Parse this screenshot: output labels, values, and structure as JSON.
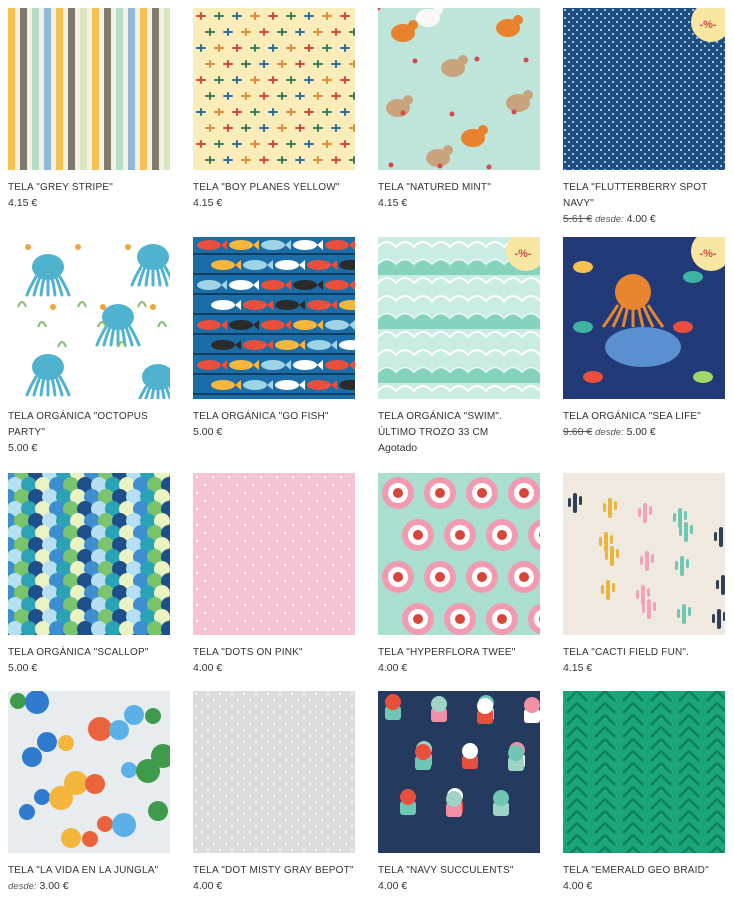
{
  "sale_badge": "-%-",
  "from_label": "desde:",
  "products": [
    {
      "title": "TELA \"GREY STRIPE\"",
      "price": "4.15 €",
      "icon": "stripes-pattern"
    },
    {
      "title": "TELA \"BOY PLANES YELLOW\"",
      "price": "4.15 €",
      "icon": "planes-pattern"
    },
    {
      "title": "TELA \"NATURED MINT\"",
      "price": "4.15 €",
      "icon": "forest-animals-pattern"
    },
    {
      "title": "TELA \"FLUTTERBERRY SPOT NAVY\"",
      "old_price": "5.61 €",
      "price": "4.00 €",
      "sale": true,
      "icon": "navy-dots-pattern"
    },
    {
      "title": "TELA ORGÁNICA \"OCTOPUS PARTY\"",
      "price": "5.00 €",
      "icon": "octopus-pattern"
    },
    {
      "title": "TELA ORGÁNICA \"GO FISH\"",
      "price": "5.00 €",
      "icon": "fish-pattern"
    },
    {
      "title": "TELA ORGÁNICA \"SWIM\". ÚLTIMO TROZO 33 CM",
      "status": "Agotado",
      "sale": true,
      "icon": "waves-pattern"
    },
    {
      "title": "TELA ORGÁNICA \"SEA LIFE\"",
      "old_price": "9.60 €",
      "price": "5.00 €",
      "sale": true,
      "icon": "sea-life-pattern"
    },
    {
      "title": "TELA ORGÁNICA \"SCALLOP\"",
      "price": "5.00 €",
      "icon": "scallop-pattern"
    },
    {
      "title": "TELA \"DOTS ON PINK\"",
      "price": "4.00 €",
      "icon": "pink-dots-pattern"
    },
    {
      "title": "TELA \"HYPERFLORA TWEE\"",
      "price": "4.00 €",
      "icon": "flowers-pattern"
    },
    {
      "title": "TELA \"CACTI FIELD FUN\".",
      "price": "4.15 €",
      "icon": "cacti-pattern"
    },
    {
      "title": "TELA \"LA VIDA EN LA JUNGLA\"",
      "price": "3.00 €",
      "from_only": true,
      "icon": "jungle-pattern"
    },
    {
      "title": "TELA \"DOT MISTY GRAY BEPOT\"",
      "price": "4.00 €",
      "icon": "gray-dots-pattern"
    },
    {
      "title": "TELA \"NAVY SUCCULENTS\"",
      "price": "4.00 €",
      "icon": "succulents-pattern"
    },
    {
      "title": "TELA \"EMERALD GEO BRAID\"",
      "price": "4.00 €",
      "icon": "geo-braid-pattern"
    }
  ],
  "colors": {
    "badge_bg": "#f7e7a2",
    "badge_text": "#d24b4b"
  }
}
